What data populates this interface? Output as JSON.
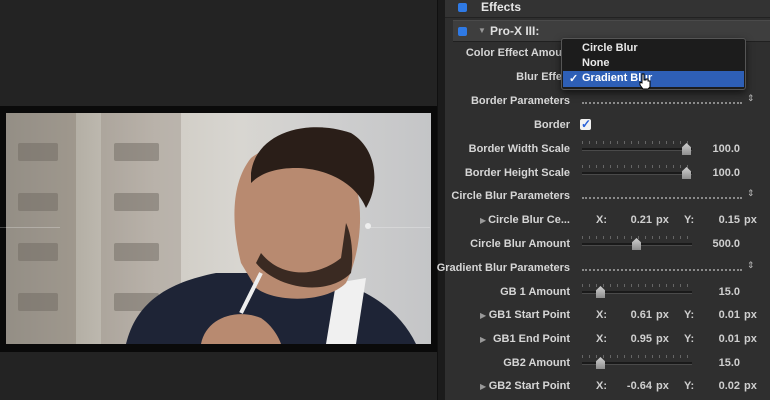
{
  "header": {
    "title": "Effects"
  },
  "section": {
    "title": "Pro-X III:"
  },
  "labels": {
    "color_effect_amount": "Color Effect Amou",
    "blur_effect": "Blur Effe",
    "border_parameters": "Border Parameters",
    "border": "Border",
    "border_width_scale": "Border Width Scale",
    "border_height_scale": "Border Height Scale",
    "circle_blur_parameters": "Circle Blur Parameters",
    "circle_blur_center": "Circle Blur Ce...",
    "circle_blur_amount": "Circle Blur Amount",
    "gradient_blur_parameters": "Gradient Blur Parameters",
    "gb1_amount": "GB 1 Amount",
    "gb1_start_point": "GB1 Start Point",
    "gb1_end_point": "GB1 End Point",
    "gb2_amount": "GB2 Amount",
    "gb2_start_point": "GB2 Start Point"
  },
  "values": {
    "border_checked": true,
    "border_width_scale": "100.0",
    "border_width_scale_fraction": 0.98,
    "border_height_scale": "100.0",
    "border_height_scale_fraction": 0.98,
    "circle_blur_center": {
      "x_label": "X:",
      "x": "0.21",
      "x_unit": "px",
      "y_label": "Y:",
      "y": "0.15",
      "y_unit": "px"
    },
    "circle_blur_amount": "500.0",
    "circle_blur_amount_fraction": 0.5,
    "gb1_amount": "15.0",
    "gb1_amount_fraction": 0.18,
    "gb1_start_point": {
      "x_label": "X:",
      "x": "0.61",
      "x_unit": "px",
      "y_label": "Y:",
      "y": "0.01",
      "y_unit": "px"
    },
    "gb1_end_point": {
      "x_label": "X:",
      "x": "0.95",
      "x_unit": "px",
      "y_label": "Y:",
      "y": "0.01",
      "y_unit": "px"
    },
    "gb2_amount": "15.0",
    "gb2_amount_fraction": 0.18,
    "gb2_start_point": {
      "x_label": "X:",
      "x": "-0.64",
      "x_unit": "px",
      "y_label": "Y:",
      "y": "0.02",
      "y_unit": "px"
    }
  },
  "blur_menu": {
    "options": [
      "Circle Blur",
      "None",
      "Gradient Blur"
    ],
    "selected": "Gradient Blur",
    "check": "✓"
  },
  "icons": {
    "disclosure_down": "▼",
    "disclosure_right": "▶",
    "stepper": "⇕"
  },
  "colors": {
    "accent": "#2f7ae5",
    "menu_highlight": "#2e5fb6",
    "panel_bg": "#2f2f2f"
  }
}
